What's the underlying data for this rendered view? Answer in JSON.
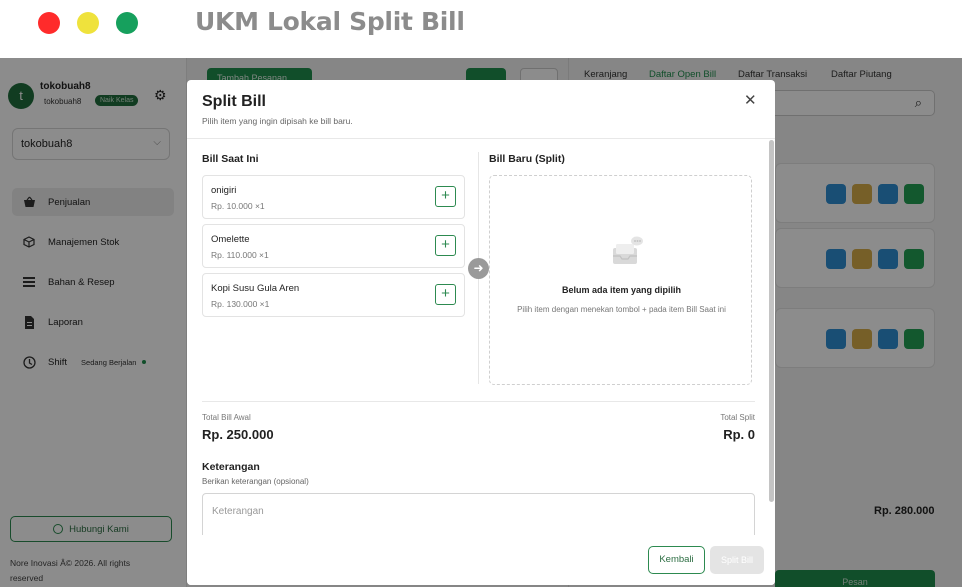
{
  "window": {
    "title": "UKM Lokal Split Bill"
  },
  "sidebar": {
    "avatar_initial": "t",
    "user_name": "tokobuah8",
    "user_sub": "tokobuah8",
    "upgrade_badge": "Naik Kelas",
    "store_select_value": "tokobuah8",
    "items": [
      {
        "label": "Penjualan",
        "icon": "basket-icon",
        "active": true
      },
      {
        "label": "Manajemen Stok",
        "icon": "box-icon"
      },
      {
        "label": "Bahan & Resep",
        "icon": "list-icon"
      },
      {
        "label": "Laporan",
        "icon": "report-icon"
      },
      {
        "label": "Shift",
        "icon": "clock-icon",
        "badge": "Sedang Berjalan"
      }
    ],
    "contact_button": "Hubungi Kami",
    "footer": "Nore Inovasi Â© 2026. All rights reserved"
  },
  "main": {
    "add_button": "Tambah Pesanan"
  },
  "right_panel": {
    "tabs": [
      "Keranjang",
      "Daftar Open Bill",
      "Daftar Transaksi",
      "Daftar Piutang"
    ],
    "active_tab": "Daftar Open Bill",
    "total": "Rp. 280.000",
    "order_button": "Pesan"
  },
  "modal": {
    "title": "Split Bill",
    "subtitle": "Pilih item yang ingin dipisah ke bill baru.",
    "current_bill_title": "Bill Saat Ini",
    "new_bill_title": "Bill Baru (Split)",
    "items": [
      {
        "name": "onigiri",
        "price": "Rp. 10.000 ×1"
      },
      {
        "name": "Omelette",
        "price": "Rp. 110.000 ×1"
      },
      {
        "name": "Kopi Susu Gula Aren",
        "price": "Rp. 130.000 ×1"
      }
    ],
    "empty_title": "Belum ada item yang dipilih",
    "empty_desc": "Pilih item dengan menekan tombol + pada item Bill Saat ini",
    "total_original_label": "Total Bill Awal",
    "total_original_value": "Rp. 250.000",
    "total_split_label": "Total Split",
    "total_split_value": "Rp. 0",
    "note_title": "Keterangan",
    "note_subtitle": "Berikan keterangan (opsional)",
    "note_placeholder": "Keterangan",
    "back_button": "Kembali",
    "split_button": "Split Bill"
  },
  "colors": {
    "brand_green": "#1f8f4e",
    "traffic_red": "#ff2b2b",
    "traffic_yellow": "#efe23c",
    "traffic_green": "#16a05d"
  }
}
